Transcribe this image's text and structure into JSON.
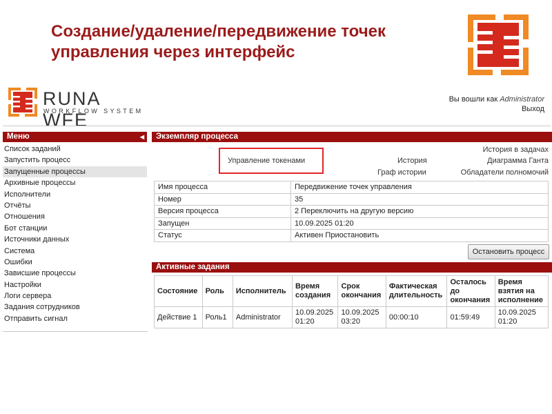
{
  "slide": {
    "title": "Создание/удаление/передвижение точек управления через интерфейс"
  },
  "header": {
    "brand": "RUNA WFE",
    "brand_sub": "WORKFLOW SYSTEM",
    "logged_in_label": "Вы вошли как",
    "user": "Administrator",
    "logout": "Выход"
  },
  "menu": {
    "title": "Меню",
    "items": [
      {
        "label": "Список заданий"
      },
      {
        "label": "Запустить процесс"
      },
      {
        "label": "Запущенные процессы",
        "active": true
      },
      {
        "label": "Архивные процессы"
      },
      {
        "label": "Исполнители"
      },
      {
        "label": "Отчёты"
      },
      {
        "label": "Отношения"
      },
      {
        "label": "Бот станции"
      },
      {
        "label": "Источники данных"
      },
      {
        "label": "Система"
      },
      {
        "label": "Ошибки"
      },
      {
        "label": "Зависшие процессы"
      },
      {
        "label": "Настройки"
      },
      {
        "label": "Логи сервера"
      },
      {
        "label": "Задания сотрудников"
      },
      {
        "label": "Отправить сигнал"
      }
    ]
  },
  "process": {
    "title": "Экземпляр процесса",
    "links": {
      "tokens": "Управление токенами",
      "history": "История",
      "history_tasks": "История в задачах",
      "gantt": "Диаграмма Ганта",
      "graph_history": "Граф истории",
      "delegates": "Обладатели полномочий"
    },
    "info": [
      {
        "key": "Имя процесса",
        "value": "Передвижение точек управления"
      },
      {
        "key": "Номер",
        "value": "35"
      },
      {
        "key": "Версия процесса",
        "value": "2 Переключить на другую версию"
      },
      {
        "key": "Запущен",
        "value": "10.09.2025 01:20"
      },
      {
        "key": "Статус",
        "value": "Активен Приостановить"
      }
    ],
    "stop_button": "Остановить процесс"
  },
  "tasks": {
    "title": "Активные задания",
    "columns": [
      "Состояние",
      "Роль",
      "Исполнитель",
      "Время создания",
      "Срок окончания",
      "Фактическая длительность",
      "Осталось до окончания",
      "Время взятия на исполнение"
    ],
    "rows": [
      [
        "Действие 1",
        "Роль1",
        "Administrator",
        "10.09.2025 01:20",
        "10.09.2025 03:20",
        "00:00:10",
        "01:59:49",
        "10.09.2025 01:20"
      ]
    ]
  },
  "colors": {
    "accent": "#9b0f0f",
    "title": "#9b1b1b",
    "highlight": "#e0262b",
    "logo_orange": "#f08a24"
  },
  "icons": {
    "menu_collapse": "triangle-left-icon",
    "slide_logo": "runa-chip-logo-icon"
  }
}
